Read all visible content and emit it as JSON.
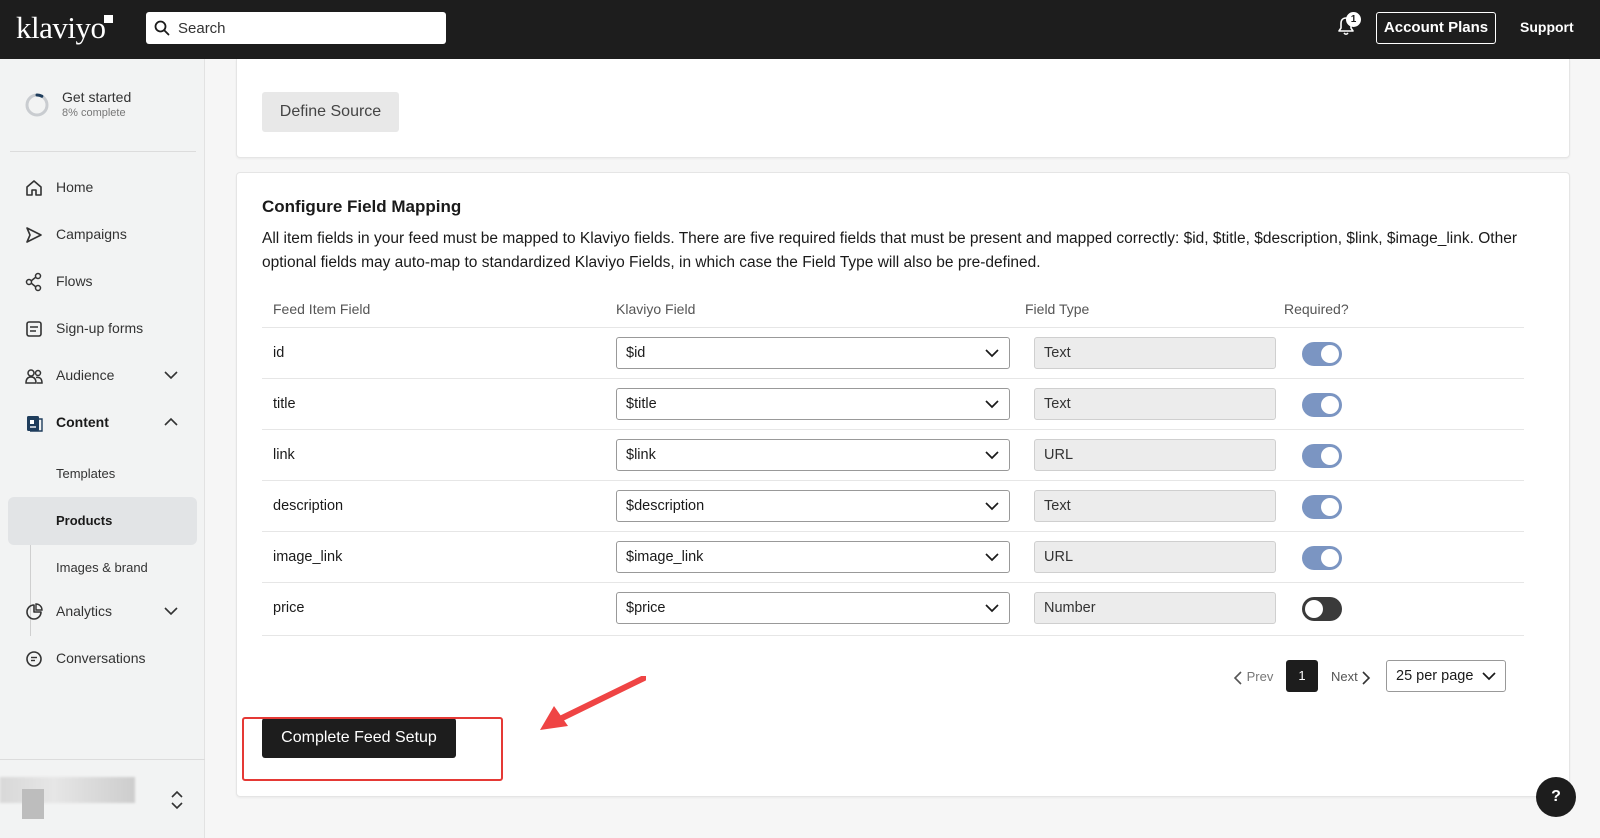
{
  "topbar": {
    "logo": "klaviyo",
    "search_placeholder": "Search",
    "notification_count": "1",
    "account_plans_label": "Account Plans",
    "support_label": "Support"
  },
  "sidebar": {
    "get_started": {
      "title": "Get started",
      "progress_text": "8% complete",
      "progress": 0.08
    },
    "items": [
      {
        "label": "Home",
        "icon": "home-icon"
      },
      {
        "label": "Campaigns",
        "icon": "send-icon"
      },
      {
        "label": "Flows",
        "icon": "flows-icon"
      },
      {
        "label": "Sign-up forms",
        "icon": "form-icon"
      },
      {
        "label": "Audience",
        "icon": "people-icon",
        "expandable": true
      },
      {
        "label": "Content",
        "icon": "content-icon",
        "expanded": true
      },
      {
        "label": "Analytics",
        "icon": "pie-chart-icon",
        "expandable": true
      },
      {
        "label": "Conversations",
        "icon": "chat-icon"
      }
    ],
    "content_subitems": [
      {
        "label": "Templates"
      },
      {
        "label": "Products",
        "active": true
      },
      {
        "label": "Images & brand"
      }
    ]
  },
  "source_card": {
    "define_source_label": "Define Source"
  },
  "mapping": {
    "title": "Configure Field Mapping",
    "description": "All item fields in your feed must be mapped to Klaviyo fields. There are five required fields that must be present and mapped correctly: $id, $title, $description, $link, $image_link. Other optional fields may auto-map to standardized Klaviyo Fields, in which case the Field Type will also be pre-defined.",
    "columns": [
      "Feed Item Field",
      "Klaviyo Field",
      "Field Type",
      "Required?"
    ],
    "rows": [
      {
        "feed_field": "id",
        "klaviyo_field": "$id",
        "field_type": "Text",
        "required": true
      },
      {
        "feed_field": "title",
        "klaviyo_field": "$title",
        "field_type": "Text",
        "required": true
      },
      {
        "feed_field": "link",
        "klaviyo_field": "$link",
        "field_type": "URL",
        "required": true
      },
      {
        "feed_field": "description",
        "klaviyo_field": "$description",
        "field_type": "Text",
        "required": true
      },
      {
        "feed_field": "image_link",
        "klaviyo_field": "$image_link",
        "field_type": "URL",
        "required": true
      },
      {
        "feed_field": "price",
        "klaviyo_field": "$price",
        "field_type": "Number",
        "required": false
      }
    ],
    "pagination": {
      "prev_label": "Prev",
      "current_page": "1",
      "next_label": "Next",
      "per_page": "25 per page"
    },
    "complete_label": "Complete Feed Setup"
  },
  "help_label": "?",
  "colors": {
    "topbar": "#1d1d1d",
    "toggle_on": "#7b95c2",
    "annotation": "#e53935"
  }
}
